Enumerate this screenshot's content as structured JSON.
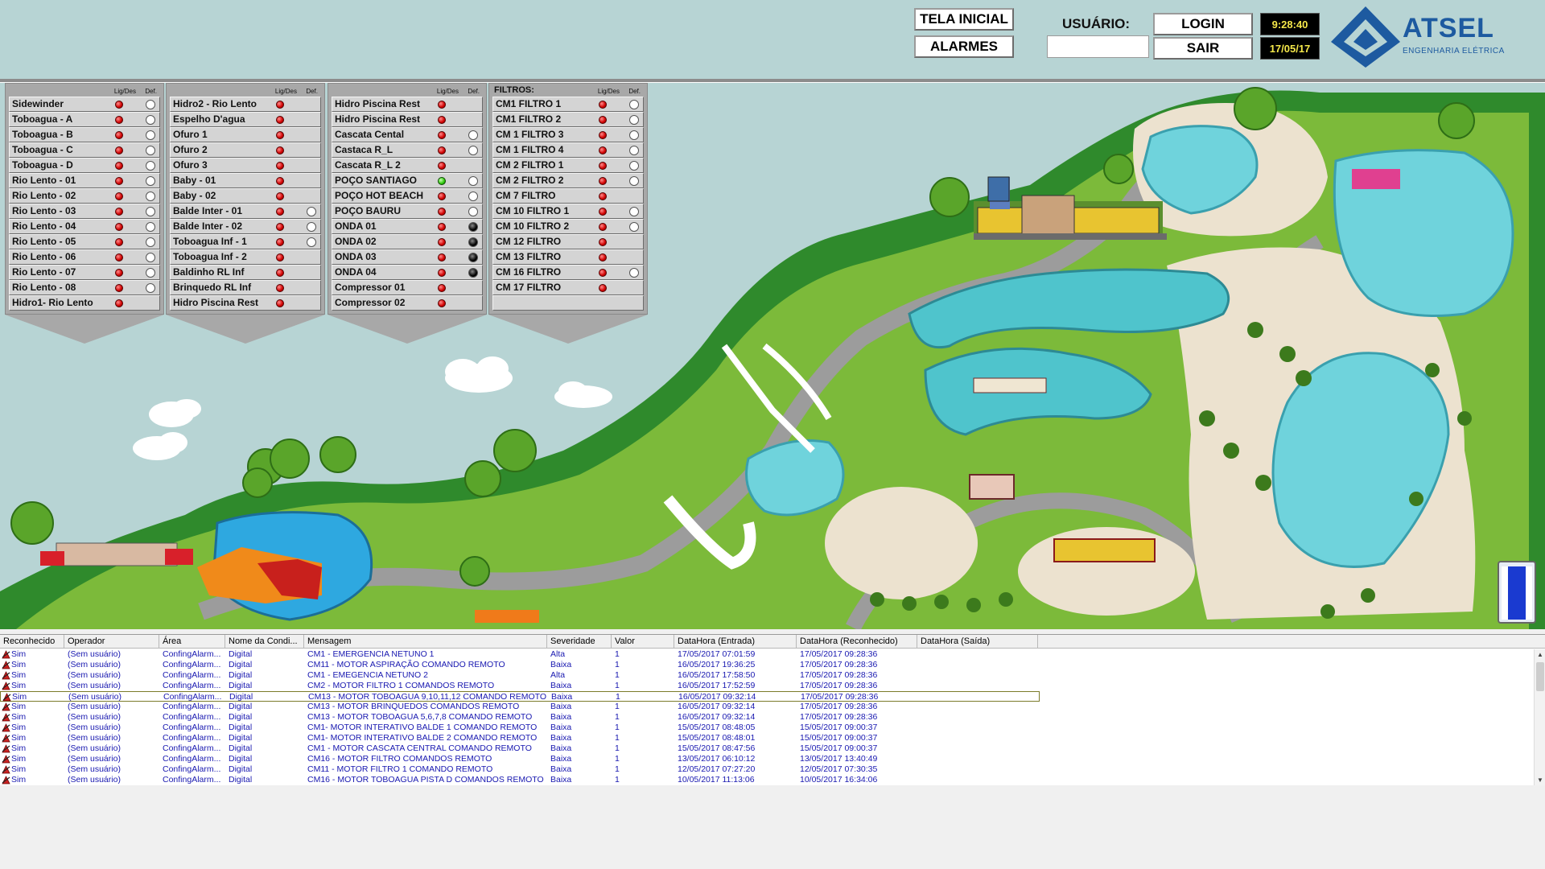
{
  "header": {
    "tela_inicial": "TELA INICIAL",
    "alarmes": "ALARMES",
    "usuario_label": "USUÁRIO:",
    "usuario_value": "",
    "login": "LOGIN",
    "sair": "SAIR",
    "time": "9:28:40",
    "date": "17/05/17",
    "brand": "ATSEL",
    "brand_sub": "ENGENHARIA ELÉTRICA"
  },
  "panel_columns": {
    "on": "Lig/Des",
    "fault": "Def."
  },
  "panels": [
    {
      "title": "",
      "items": [
        {
          "label": "Sidewinder",
          "state": "off",
          "def": "white"
        },
        {
          "label": "Toboagua - A",
          "state": "off",
          "def": "white"
        },
        {
          "label": "Toboagua - B",
          "state": "off",
          "def": "white"
        },
        {
          "label": "Toboagua - C",
          "state": "off",
          "def": "white"
        },
        {
          "label": "Toboagua - D",
          "state": "off",
          "def": "white"
        },
        {
          "label": "Rio Lento - 01",
          "state": "off",
          "def": "white"
        },
        {
          "label": "Rio Lento - 02",
          "state": "off",
          "def": "white"
        },
        {
          "label": "Rio Lento - 03",
          "state": "off",
          "def": "white"
        },
        {
          "label": "Rio Lento - 04",
          "state": "off",
          "def": "white"
        },
        {
          "label": "Rio Lento - 05",
          "state": "off",
          "def": "white"
        },
        {
          "label": "Rio Lento - 06",
          "state": "off",
          "def": "white"
        },
        {
          "label": "Rio Lento - 07",
          "state": "off",
          "def": "white"
        },
        {
          "label": "Rio Lento - 08",
          "state": "off",
          "def": "white"
        },
        {
          "label": "Hidro1- Rio Lento",
          "state": "off",
          "def": "none"
        }
      ]
    },
    {
      "title": "",
      "items": [
        {
          "label": "Hidro2 - Rio Lento",
          "state": "off",
          "def": "none"
        },
        {
          "label": "Espelho D'agua",
          "state": "off",
          "def": "none"
        },
        {
          "label": "Ofuro 1",
          "state": "off",
          "def": "none"
        },
        {
          "label": "Ofuro 2",
          "state": "off",
          "def": "none"
        },
        {
          "label": "Ofuro 3",
          "state": "off",
          "def": "none"
        },
        {
          "label": "Baby - 01",
          "state": "off",
          "def": "none"
        },
        {
          "label": "Baby - 02",
          "state": "off",
          "def": "none"
        },
        {
          "label": "Balde Inter - 01",
          "state": "off",
          "def": "white"
        },
        {
          "label": "Balde Inter - 02",
          "state": "off",
          "def": "white"
        },
        {
          "label": "Toboagua Inf - 1",
          "state": "off",
          "def": "white"
        },
        {
          "label": "Toboagua Inf - 2",
          "state": "off",
          "def": "none"
        },
        {
          "label": "Baldinho RL Inf",
          "state": "off",
          "def": "none"
        },
        {
          "label": "Brinquedo RL Inf",
          "state": "off",
          "def": "none"
        },
        {
          "label": "Hidro Piscina Rest",
          "state": "off",
          "def": "none"
        }
      ]
    },
    {
      "title": "",
      "items": [
        {
          "label": "Hidro Piscina Rest",
          "state": "off",
          "def": "none"
        },
        {
          "label": "Hidro Piscina Rest",
          "state": "off",
          "def": "none"
        },
        {
          "label": "Cascata Cental",
          "state": "off",
          "def": "white"
        },
        {
          "label": "Castaca R_L",
          "state": "off",
          "def": "white"
        },
        {
          "label": "Cascata R_L 2",
          "state": "off",
          "def": "none"
        },
        {
          "label": "POÇO SANTIAGO",
          "state": "on",
          "def": "white"
        },
        {
          "label": "POÇO HOT BEACH",
          "state": "off",
          "def": "white"
        },
        {
          "label": "POÇO BAURU",
          "state": "off",
          "def": "white"
        },
        {
          "label": "ONDA 01",
          "state": "off",
          "def": "dark"
        },
        {
          "label": "ONDA 02",
          "state": "off",
          "def": "dark"
        },
        {
          "label": "ONDA 03",
          "state": "off",
          "def": "dark"
        },
        {
          "label": "ONDA 04",
          "state": "off",
          "def": "dark"
        },
        {
          "label": "Compressor 01",
          "state": "off",
          "def": "none"
        },
        {
          "label": "Compressor 02",
          "state": "off",
          "def": "none"
        }
      ]
    },
    {
      "title": "FILTROS:",
      "items": [
        {
          "label": "CM1 FILTRO 1",
          "state": "off",
          "def": "white"
        },
        {
          "label": "CM1 FILTRO 2",
          "state": "off",
          "def": "white"
        },
        {
          "label": "CM 1 FILTRO 3",
          "state": "off",
          "def": "white"
        },
        {
          "label": "CM 1 FILTRO 4",
          "state": "off",
          "def": "white"
        },
        {
          "label": "CM 2 FILTRO 1",
          "state": "off",
          "def": "white"
        },
        {
          "label": "CM 2 FILTRO 2",
          "state": "off",
          "def": "white"
        },
        {
          "label": "CM 7  FILTRO",
          "state": "off",
          "def": "none"
        },
        {
          "label": "CM 10 FILTRO 1",
          "state": "off",
          "def": "white"
        },
        {
          "label": "CM 10 FILTRO 2",
          "state": "off",
          "def": "white"
        },
        {
          "label": "CM 12 FILTRO",
          "state": "off",
          "def": "none"
        },
        {
          "label": "CM 13 FILTRO",
          "state": "off",
          "def": "none"
        },
        {
          "label": "CM 16 FILTRO",
          "state": "off",
          "def": "white"
        },
        {
          "label": "CM 17 FILTRO",
          "state": "off",
          "def": "none"
        },
        {
          "label": "",
          "state": "none",
          "def": "none"
        }
      ]
    }
  ],
  "alarm_table": {
    "headers": [
      "Reconhecido",
      "Operador",
      "Área",
      "Nome da Condi...",
      "Mensagem",
      "Severidade",
      "Valor",
      "DataHora (Entrada)",
      "DataHora (Reconhecido)",
      "DataHora (Saída)"
    ],
    "rows": [
      [
        "Sim",
        "(Sem usuário)",
        "ConfingAlarm...",
        "Digital",
        "CM1 - EMERGENCIA NETUNO 1",
        "Alta",
        "1",
        "17/05/2017 07:01:59",
        "17/05/2017 09:28:36",
        ""
      ],
      [
        "Sim",
        "(Sem usuário)",
        "ConfingAlarm...",
        "Digital",
        "CM11 - MOTOR ASPIRAÇÃO COMANDO REMOTO",
        "Baixa",
        "1",
        "16/05/2017 19:36:25",
        "17/05/2017 09:28:36",
        ""
      ],
      [
        "Sim",
        "(Sem usuário)",
        "ConfingAlarm...",
        "Digital",
        "CM1 - EMEGENCIA NETUNO 2",
        "Alta",
        "1",
        "16/05/2017 17:58:50",
        "17/05/2017 09:28:36",
        ""
      ],
      [
        "Sim",
        "(Sem usuário)",
        "ConfingAlarm...",
        "Digital",
        "CM2 - MOTOR FILTRO 1 COMANDOS REMOTO",
        "Baixa",
        "1",
        "16/05/2017 17:52:59",
        "17/05/2017 09:28:36",
        ""
      ],
      [
        "Sim",
        "(Sem usuário)",
        "ConfingAlarm...",
        "Digital",
        "CM13 - MOTOR TOBOAGUA 9,10,11,12 COMANDO REMOTO",
        "Baixa",
        "1",
        "16/05/2017 09:32:14",
        "17/05/2017 09:28:36",
        ""
      ],
      [
        "Sim",
        "(Sem usuário)",
        "ConfingAlarm...",
        "Digital",
        "CM13 - MOTOR BRINQUEDOS COMANDOS REMOTO",
        "Baixa",
        "1",
        "16/05/2017 09:32:14",
        "17/05/2017 09:28:36",
        ""
      ],
      [
        "Sim",
        "(Sem usuário)",
        "ConfingAlarm...",
        "Digital",
        "CM13 - MOTOR TOBOAGUA 5,6,7,8 COMANDO REMOTO",
        "Baixa",
        "1",
        "16/05/2017 09:32:14",
        "17/05/2017 09:28:36",
        ""
      ],
      [
        "Sim",
        "(Sem usuário)",
        "ConfingAlarm...",
        "Digital",
        "CM1- MOTOR INTERATIVO BALDE 1 COMANDO REMOTO",
        "Baixa",
        "1",
        "15/05/2017 08:48:05",
        "15/05/2017 09:00:37",
        ""
      ],
      [
        "Sim",
        "(Sem usuário)",
        "ConfingAlarm...",
        "Digital",
        "CM1- MOTOR INTERATIVO BALDE 2 COMANDO REMOTO",
        "Baixa",
        "1",
        "15/05/2017 08:48:01",
        "15/05/2017 09:00:37",
        ""
      ],
      [
        "Sim",
        "(Sem usuário)",
        "ConfingAlarm...",
        "Digital",
        "CM1 - MOTOR CASCATA CENTRAL COMANDO REMOTO",
        "Baixa",
        "1",
        "15/05/2017 08:47:56",
        "15/05/2017 09:00:37",
        ""
      ],
      [
        "Sim",
        "(Sem usuário)",
        "ConfingAlarm...",
        "Digital",
        "CM16 - MOTOR FILTRO COMANDOS REMOTO",
        "Baixa",
        "1",
        "13/05/2017 06:10:12",
        "13/05/2017 13:40:49",
        ""
      ],
      [
        "Sim",
        "(Sem usuário)",
        "ConfingAlarm...",
        "Digital",
        "CM11 - MOTOR FILTRO 1 COMANDO REMOTO",
        "Baixa",
        "1",
        "12/05/2017 07:27:20",
        "12/05/2017 07:30:35",
        ""
      ],
      [
        "Sim",
        "(Sem usuário)",
        "ConfingAlarm...",
        "Digital",
        "CM16 - MOTOR TOBOAGUA PISTA D COMANDOS REMOTO",
        "Baixa",
        "1",
        "10/05/2017 11:13:06",
        "10/05/2017 16:34:06",
        ""
      ]
    ]
  }
}
